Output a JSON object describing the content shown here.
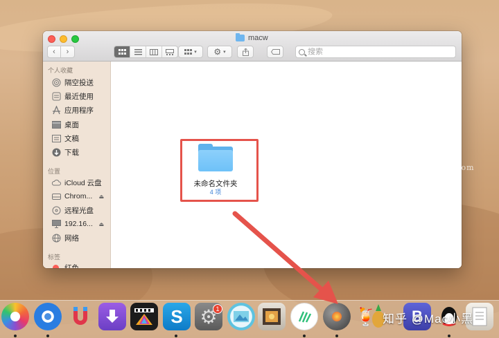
{
  "window": {
    "title": "macw",
    "search_placeholder": "搜索"
  },
  "sidebar": {
    "favorites_header": "个人收藏",
    "favorites": [
      {
        "label": "隔空投送",
        "icon": "airdrop-icon"
      },
      {
        "label": "最近使用",
        "icon": "recents-icon"
      },
      {
        "label": "应用程序",
        "icon": "applications-icon"
      },
      {
        "label": "桌面",
        "icon": "desktop-icon"
      },
      {
        "label": "文稿",
        "icon": "documents-icon"
      },
      {
        "label": "下载",
        "icon": "downloads-icon"
      }
    ],
    "locations_header": "位置",
    "locations": [
      {
        "label": "iCloud 云盘",
        "icon": "cloud-icon"
      },
      {
        "label": "Chrom...",
        "icon": "drive-icon"
      },
      {
        "label": "远程光盘",
        "icon": "disc-icon"
      },
      {
        "label": "192.16...",
        "icon": "monitor-icon"
      },
      {
        "label": "网络",
        "icon": "network-icon"
      }
    ],
    "tags_header": "标签",
    "tags": [
      {
        "label": "红色",
        "color": "#fc5f57"
      }
    ]
  },
  "content": {
    "folder_name": "未命名文件夹",
    "folder_count": "4 项"
  },
  "watermark": "www.MacW.com",
  "dock": {
    "notification_badge": "1",
    "overlay_text": "知乎 @Mac小黑"
  }
}
